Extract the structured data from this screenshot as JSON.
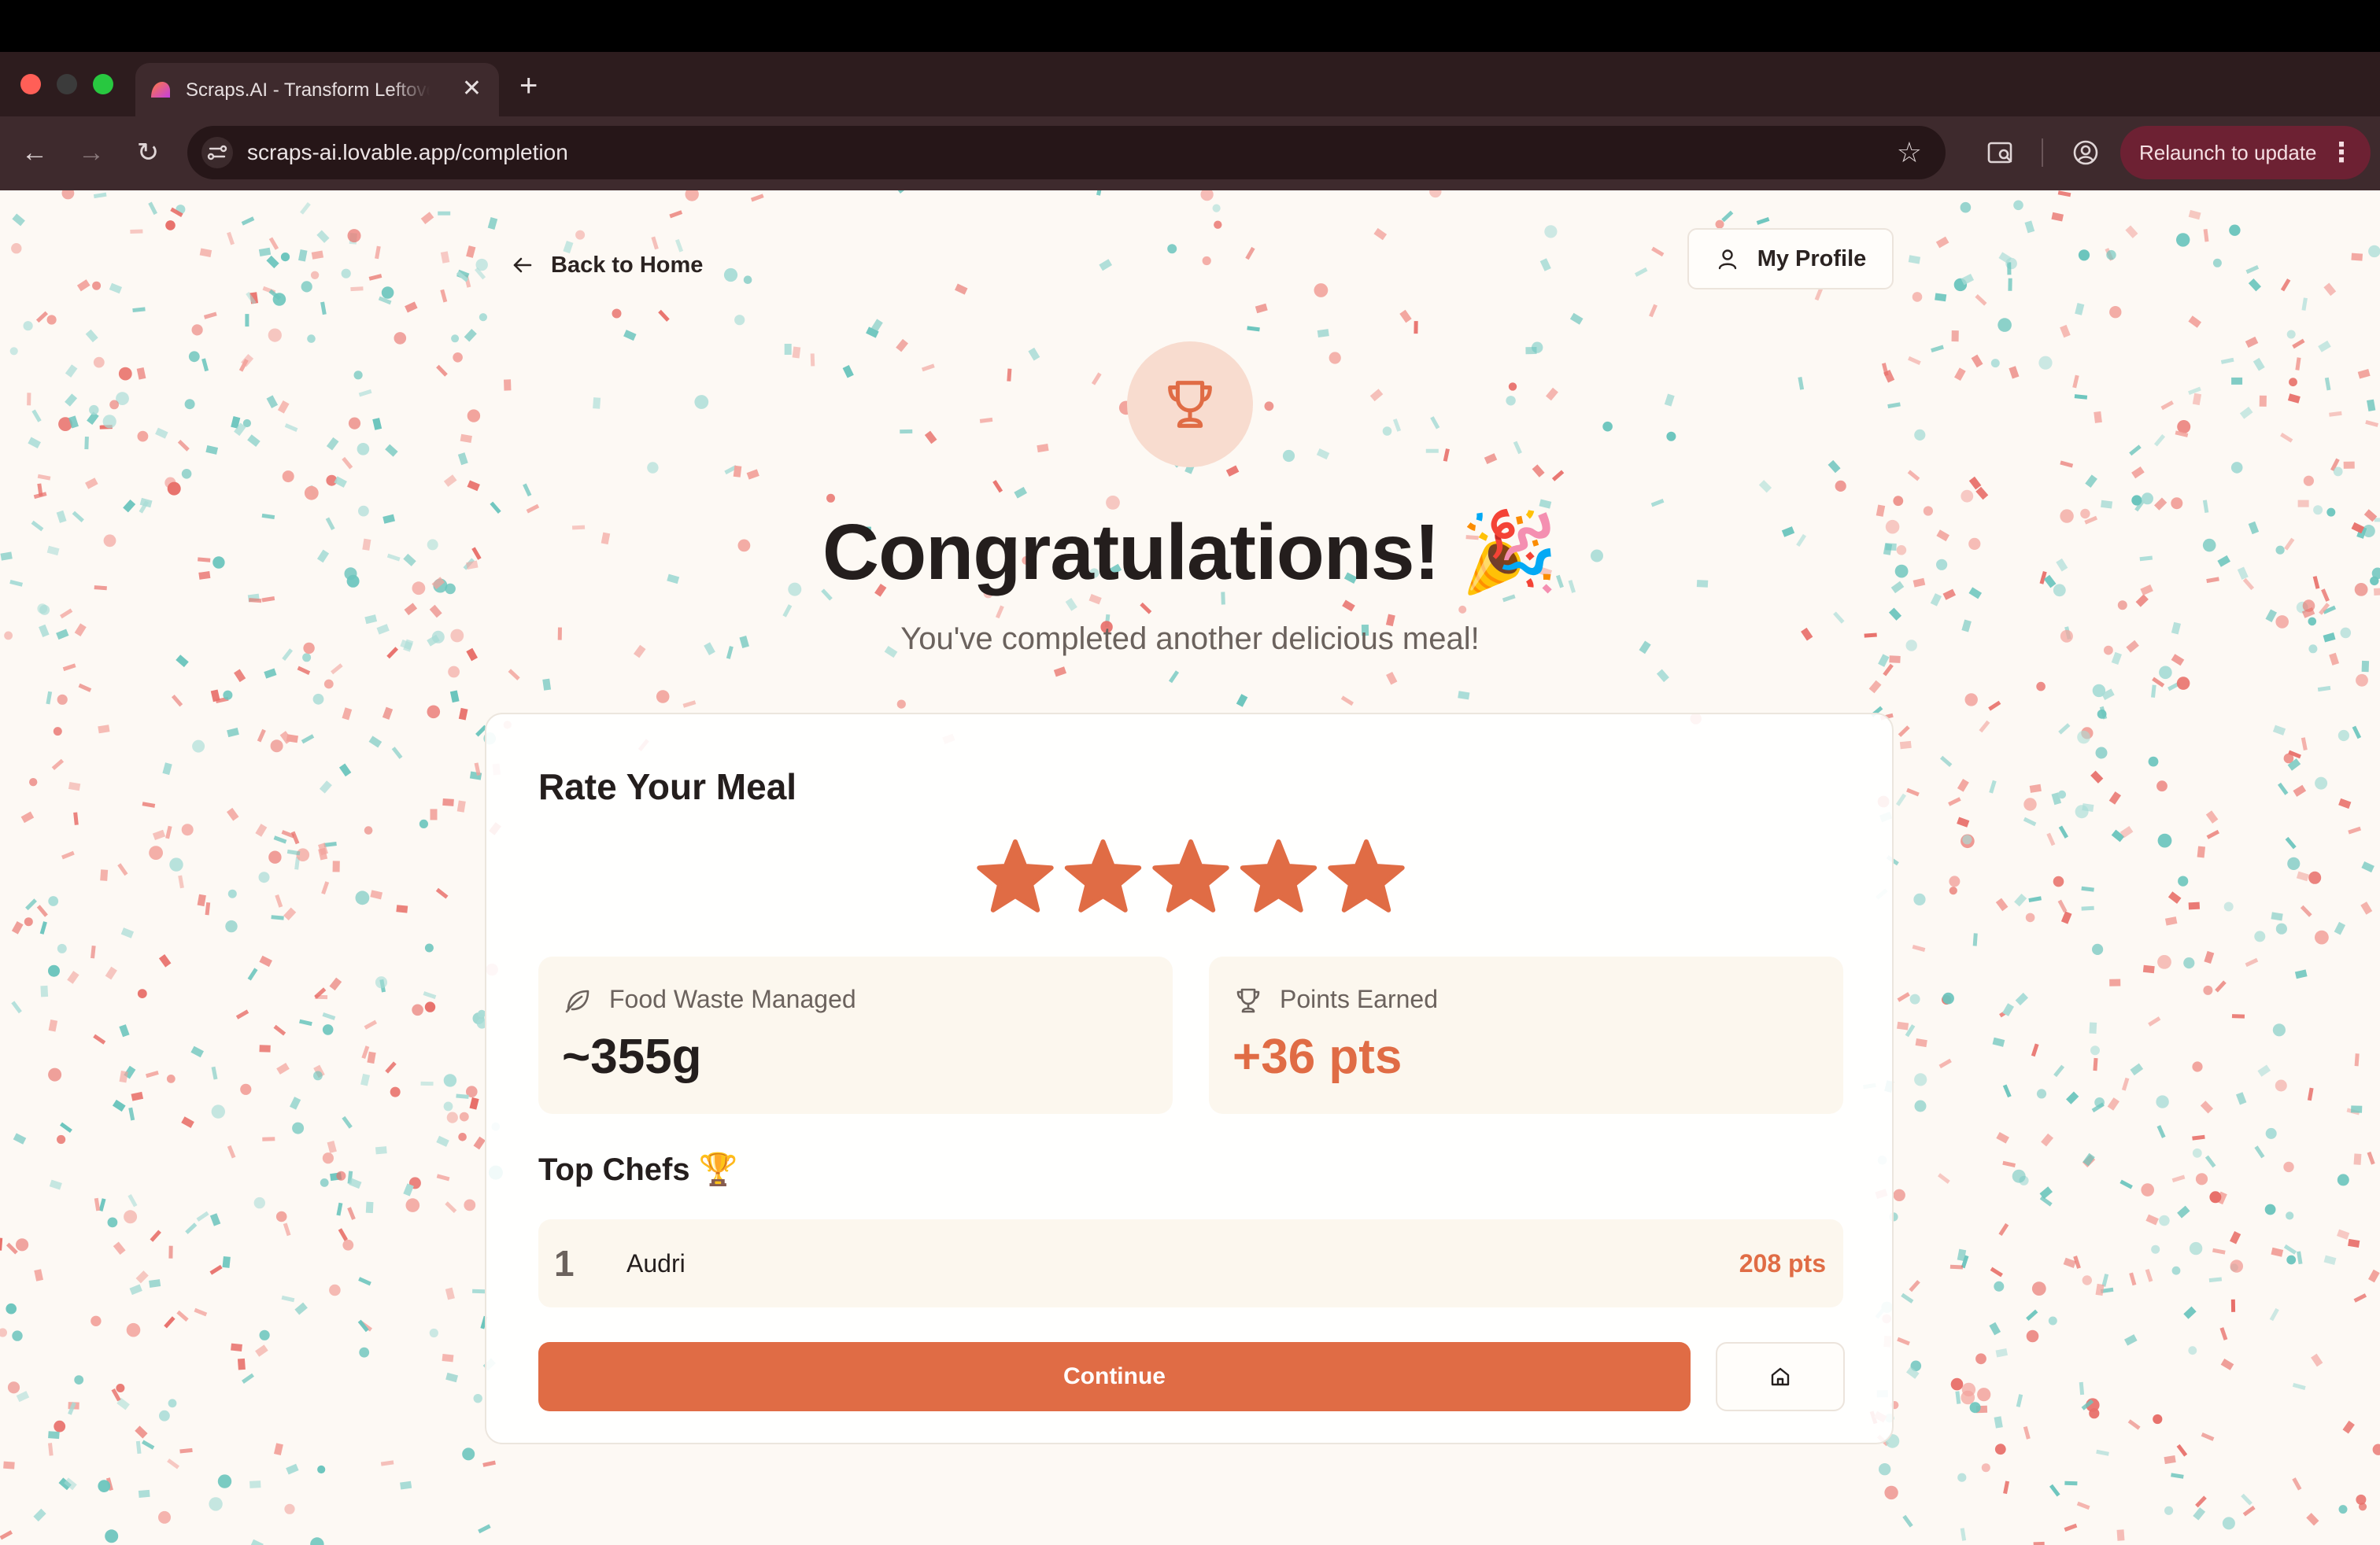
{
  "browser": {
    "tab_title": "Scraps.AI - Transform Leftovers",
    "tab_close": "✕",
    "new_tab": "+",
    "url": "scraps-ai.lovable.app/completion",
    "relaunch_label": "Relaunch to update",
    "kebab": "⋮",
    "nav_back": "←",
    "nav_forward": "→",
    "reload": "↻",
    "bookmark_star": "☆",
    "traffic_lights": [
      "#ff5f57",
      "#3b3b3b",
      "#28c840"
    ]
  },
  "header": {
    "back_label": "Back to Home",
    "profile_label": "My Profile"
  },
  "hero": {
    "heading": "Congratulations! 🎉",
    "subheading": "You've completed another delicious meal!"
  },
  "rating": {
    "title": "Rate Your Meal",
    "value": 5,
    "max": 5
  },
  "stats": {
    "food_waste_label": "Food Waste Managed",
    "food_waste_value": "~355g",
    "points_label": "Points Earned",
    "points_value": "+36 pts"
  },
  "leaderboard": {
    "title": "Top Chefs 🏆",
    "rows": [
      {
        "rank": "1",
        "name": "Audri",
        "points": "208 pts"
      }
    ]
  },
  "actions": {
    "continue_label": "Continue"
  },
  "colors": {
    "accent": "#e06c45",
    "accent_soft": "#f8dccf",
    "card_tint": "#fcf7ee",
    "confetti": [
      "#e8706a",
      "#6cc5bd",
      "#a8dcd6",
      "#f2a39c"
    ]
  }
}
